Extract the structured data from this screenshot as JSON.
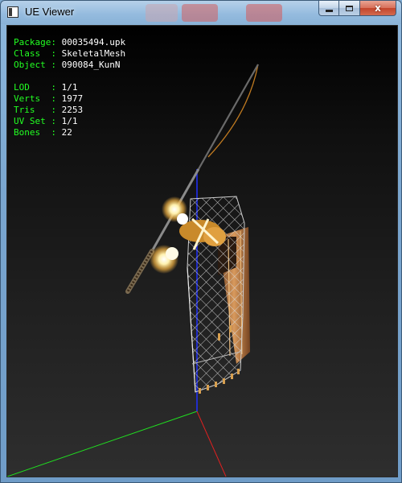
{
  "window": {
    "title": "UE Viewer",
    "close_glyph": "x"
  },
  "icons": {
    "app": "app-window-icon",
    "minimize": "minimize-icon",
    "maximize": "maximize-icon",
    "close": "close-icon"
  },
  "info": {
    "package": {
      "label": "Package:",
      "value": "00035494.upk"
    },
    "class": {
      "label": "Class  :",
      "value": "SkeletalMesh"
    },
    "object": {
      "label": "Object :",
      "value": "090084_KunN"
    },
    "lod": {
      "label": "LOD    :",
      "value": "1/1"
    },
    "verts": {
      "label": "Verts  :",
      "value": "1977"
    },
    "tris": {
      "label": "Tris   :",
      "value": "2253"
    },
    "uvset": {
      "label": "UV Set :",
      "value": "1/1"
    },
    "bones": {
      "label": "Bones  :",
      "value": "22"
    }
  },
  "colors": {
    "label_green": "#22ff22",
    "value_white": "#ffffff",
    "viewport_top": "#000000",
    "viewport_bottom": "#2e2e2e",
    "axis_x": "#ff2020",
    "axis_y": "#20ff20",
    "axis_z": "#2030ff"
  }
}
